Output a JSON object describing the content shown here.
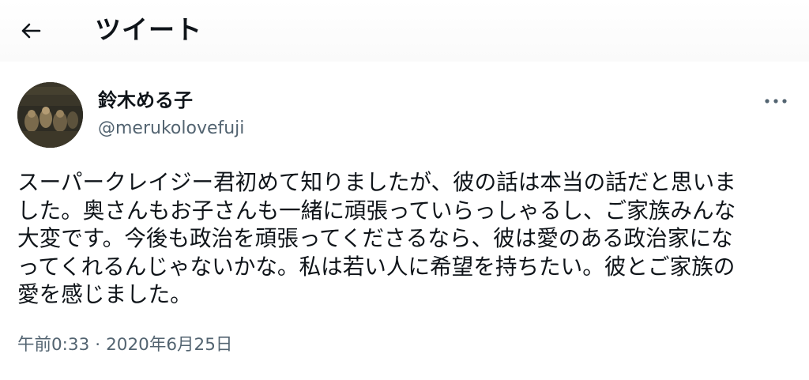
{
  "header": {
    "back_icon": "arrow-left-icon",
    "title": "ツイート"
  },
  "tweet": {
    "author": {
      "name": "鈴木める子",
      "handle": "@merukolovefuji",
      "avatar_icon": "user-avatar-photo"
    },
    "more_icon": "more-horizontal-icon",
    "text_lines": [
      "スーパークレイジー君初めて知りましたが、彼の話は本当の話だと思いま",
      "した。奥さんもお子さんも一緒に頑張っていらっしゃるし、ご家族みんな",
      "大変です。今後も政治を頑張ってくださるなら、彼は愛のある政治家にな",
      "ってくれるんじゃないかな。私は若い人に希望を持ちたい。彼とご家族の",
      "愛を感じました。"
    ],
    "time": "午前0:33",
    "separator": "·",
    "date": "2020年6月25日"
  },
  "colors": {
    "text_primary": "#0f1419",
    "text_secondary": "#536471",
    "background": "#ffffff"
  }
}
